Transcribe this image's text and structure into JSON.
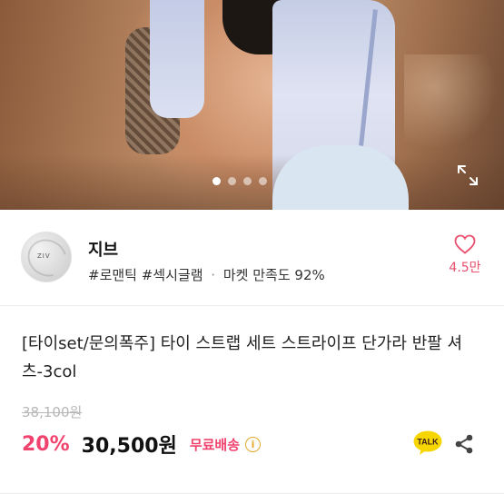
{
  "gallery": {
    "slide_count": 4,
    "active_index": 0
  },
  "seller": {
    "avatar_text": "ZIV",
    "name": "지브",
    "tags": "#로맨틱 #섹시글램",
    "separator": "·",
    "satisfaction": "마켓 만족도 92%",
    "likes": "4.5만"
  },
  "product": {
    "title": "[타이set/문의폭주] 타이 스트랩 세트 스트라이프 단가라 반팔 셔츠-3col",
    "original_price": "38,100원",
    "discount": "20%",
    "price": "30,500원",
    "shipping": "무료배송",
    "info_symbol": "i"
  },
  "actions": {
    "talk_label": "TALK"
  },
  "colors": {
    "accent": "#f0436d",
    "like": "#e8506e",
    "talk_bg": "#f7d600",
    "info": "#e2a92b"
  },
  "icons": [
    "expand-icon",
    "heart-icon",
    "info-icon",
    "kakao-talk-icon",
    "share-icon"
  ]
}
